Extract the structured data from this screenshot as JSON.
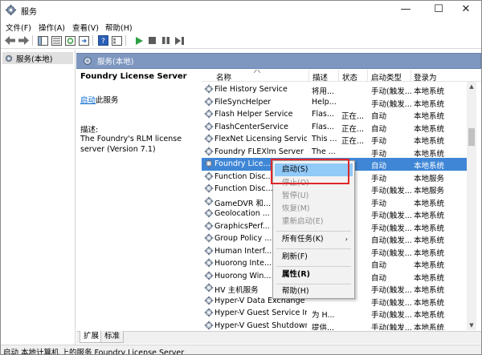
{
  "window": {
    "title": "服务",
    "buttons": {
      "minimize": "—",
      "maximize": "☐",
      "close": "✕"
    }
  },
  "menu": [
    "文件(F)",
    "操作(A)",
    "查看(V)",
    "帮助(H)"
  ],
  "tree": {
    "item": "服务(本地)"
  },
  "header": {
    "title": "服务(本地)"
  },
  "description_panel": {
    "service_name": "Foundry License Server",
    "start_link": "启动",
    "start_suffix": "此服务",
    "desc_label": "描述:",
    "desc_text": "The Foundry's RLM license server (Version 7.1)"
  },
  "columns": {
    "name": "名称",
    "description": "描述",
    "status": "状态",
    "startup": "启动类型",
    "logon": "登录为"
  },
  "rows": [
    {
      "name": "File History Service",
      "description": "将用...",
      "status": "",
      "startup": "手动(触发...",
      "logon": "本地系统"
    },
    {
      "name": "FileSyncHelper",
      "description": "Help...",
      "status": "",
      "startup": "手动(触发...",
      "logon": "本地系统"
    },
    {
      "name": "Flash Helper Service",
      "description": "Flas...",
      "status": "正在...",
      "startup": "自动",
      "logon": "本地系统"
    },
    {
      "name": "FlashCenterService",
      "description": "Flas...",
      "status": "正在...",
      "startup": "自动",
      "logon": "本地系统"
    },
    {
      "name": "FlexNet Licensing Service",
      "description": "This ...",
      "status": "正在...",
      "startup": "手动",
      "logon": "本地系统"
    },
    {
      "name": "Foundry FLEXlm Server",
      "description": "The ...",
      "status": "",
      "startup": "手动",
      "logon": "本地系统"
    },
    {
      "name": "Foundry Lice...",
      "description": "Th...",
      "status": "",
      "startup": "自动",
      "logon": "本地系统"
    },
    {
      "name": "Function Disc...",
      "description": "",
      "status": "",
      "startup": "手动",
      "logon": "本地服务"
    },
    {
      "name": "Function Disc...",
      "description": "",
      "status": "",
      "startup": "手动(触发...",
      "logon": "本地服务"
    },
    {
      "name": "GameDVR 和...",
      "description": "",
      "status": "",
      "startup": "手动",
      "logon": "本地系统"
    },
    {
      "name": "Geolocation ...",
      "description": "",
      "status": "",
      "startup": "手动(触发...",
      "logon": "本地系统"
    },
    {
      "name": "GraphicsPerf...",
      "description": "",
      "status": "",
      "startup": "手动(触发...",
      "logon": "本地系统"
    },
    {
      "name": "Group Policy ...",
      "description": "",
      "status": "",
      "startup": "自动(触发...",
      "logon": "本地系统"
    },
    {
      "name": "Human Interf...",
      "description": "",
      "status": "",
      "startup": "手动(触发...",
      "logon": "本地系统"
    },
    {
      "name": "Huorong Inte...",
      "description": "",
      "status": "",
      "startup": "自动",
      "logon": "本地系统"
    },
    {
      "name": "Huorong Win...",
      "description": "",
      "status": "",
      "startup": "自动",
      "logon": "本地系统"
    },
    {
      "name": "HV 主机服务",
      "description": "",
      "status": "",
      "startup": "手动(触发...",
      "logon": "本地系统"
    },
    {
      "name": "Hyper-V Data Exchange ...",
      "description": "",
      "status": "",
      "startup": "手动(触发...",
      "logon": "本地系统"
    },
    {
      "name": "Hyper-V Guest Service In...",
      "description": "为 H...",
      "status": "",
      "startup": "手动(触发...",
      "logon": "本地系统"
    },
    {
      "name": "Hyper-V Guest Shutdown...",
      "description": "提供...",
      "status": "",
      "startup": "手动(触发...",
      "logon": "本地系统"
    }
  ],
  "context_menu": {
    "start": "启动(S)",
    "stop": "停止(O)",
    "pause": "暂停(U)",
    "resume": "恢复(M)",
    "restart": "重新启动(E)",
    "all_tasks": "所有任务(K)",
    "refresh": "刷新(F)",
    "properties": "属性(R)",
    "help": "帮助(H)"
  },
  "tabs": [
    "扩展",
    "标准"
  ],
  "status_bar": "启动 本地计算机 上的服务 Foundry License Server",
  "colors": {
    "header_bg": "#7e97c0",
    "selected_row": "#3f86d6",
    "menu_hover": "#91c9f7",
    "highlight_box": "#e0262b"
  }
}
